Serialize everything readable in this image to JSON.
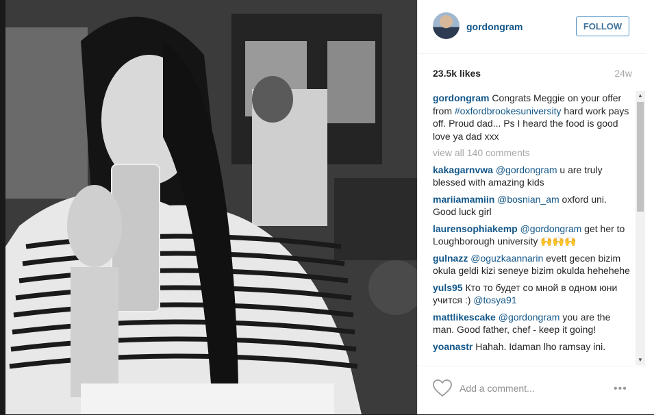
{
  "post": {
    "username": "gordongram",
    "follow_label": "FOLLOW",
    "likes": "23.5k likes",
    "age": "24w"
  },
  "caption": {
    "username": "gordongram",
    "text_before": " Congrats Meggie on your offer from ",
    "hashtag": "#oxfordbrookesuniversity",
    "text_after": " hard work pays off. Proud dad... Ps I heard the food is good love ya dad xxx"
  },
  "view_all": "view all 140 comments",
  "comments": [
    {
      "user": "kakagarnvwa",
      "mention": "@gordongram",
      "text": " u are truly blessed with amazing kids"
    },
    {
      "user": "mariiamamiin",
      "mention": "@bosnian_am",
      "text": " oxford uni. Good luck girl"
    },
    {
      "user": "laurensophiakemp",
      "mention": "@gordongram",
      "text": " get her to Loughborough university 🙌🙌🙌"
    },
    {
      "user": "gulnazz",
      "mention": "@oguzkaannarin",
      "text": " evett gecen bizim okula geldi kizi seneye bizim okulda hehehehe"
    },
    {
      "user": "yuls95",
      "text_before": " Кто то будет со мной в одном юни учится :) ",
      "mention": "@tosya91",
      "text": ""
    },
    {
      "user": "mattlikescake",
      "mention": "@gordongram",
      "text": " you are the man. Good father, chef - keep it going!"
    },
    {
      "user": "yoanastr",
      "mention": "",
      "text": " Hahah. Idaman lho ramsay ini."
    }
  ],
  "footer": {
    "add_comment_placeholder": "Add a comment...",
    "more_icon": "•••"
  },
  "icons": {
    "heart": "heart-icon",
    "more": "more-options-icon"
  }
}
